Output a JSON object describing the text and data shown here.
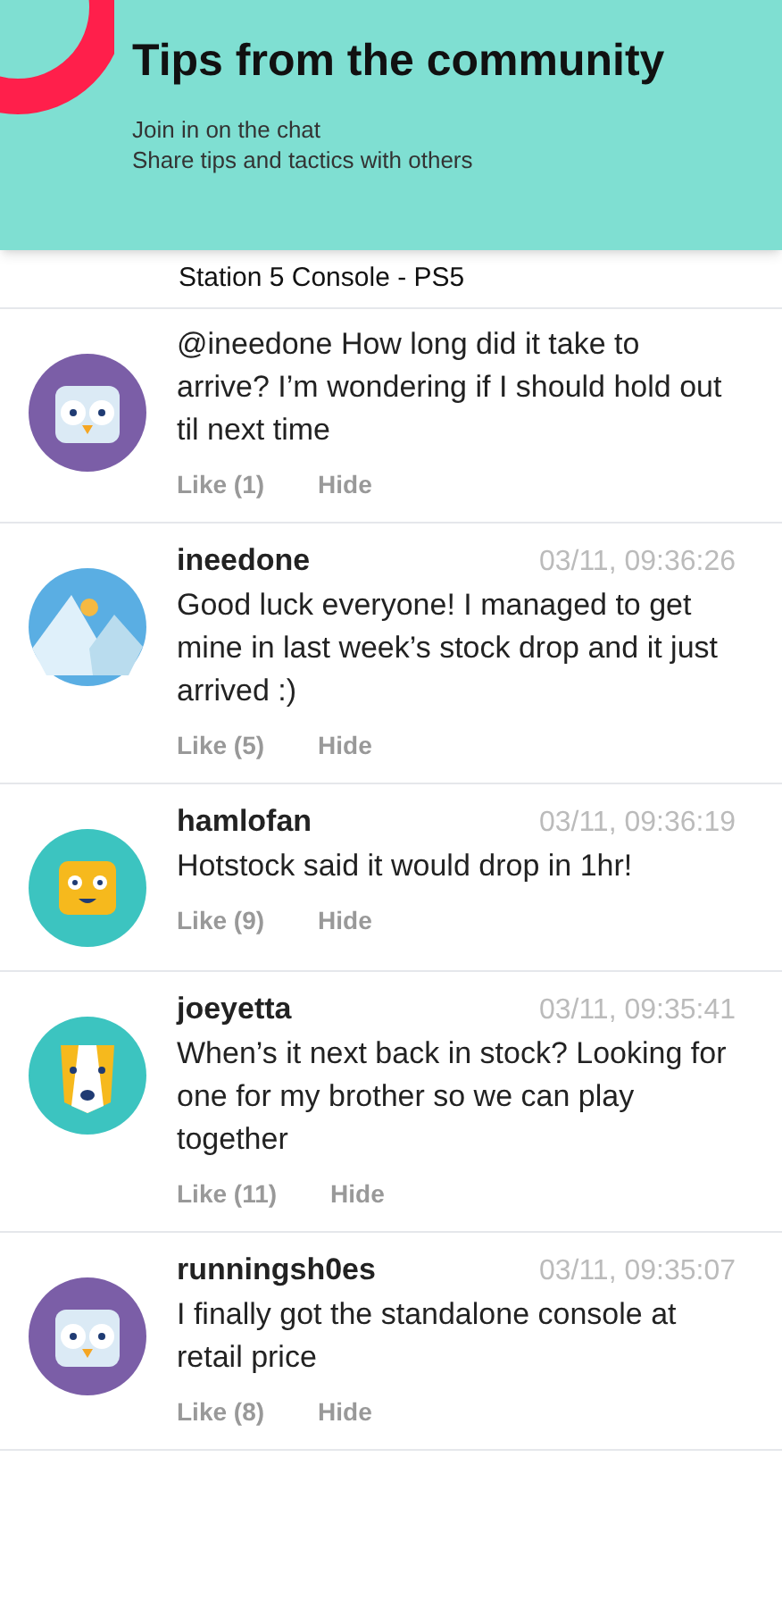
{
  "banner": {
    "title": "Tips from the community",
    "lines": [
      "Join in on the chat",
      "Share tips and tactics with others"
    ]
  },
  "header": {
    "title": "Station 5 Console - PS5"
  },
  "messages": [
    {
      "kind": "owl",
      "text": "@ineedone How long did it take to arrive? I’m wondering if I should hold out til next time",
      "like": "Like (1)",
      "hide": "Hide"
    },
    {
      "kind": "mountain",
      "user": "ineedone",
      "time": "03/11, 09:36:26",
      "text": "Good luck everyone! I managed to get mine in last week’s stock drop and it just arrived :)",
      "like": "Like (5)",
      "hide": "Hide"
    },
    {
      "kind": "robot",
      "user": "hamlofan",
      "time": "03/11, 09:36:19",
      "text": "Hotstock said it would drop in 1hr!",
      "like": "Like (9)",
      "hide": "Hide"
    },
    {
      "kind": "dog",
      "user": "joeyetta",
      "time": "03/11, 09:35:41",
      "text": "When’s it next back in stock? Looking for one for my brother so we can play together",
      "like": "Like (11)",
      "hide": "Hide"
    },
    {
      "kind": "owl",
      "user": "runningsh0es",
      "time": "03/11, 09:35:07",
      "text": "I finally got the standalone console at retail price",
      "like": "Like (8)",
      "hide": "Hide"
    }
  ]
}
